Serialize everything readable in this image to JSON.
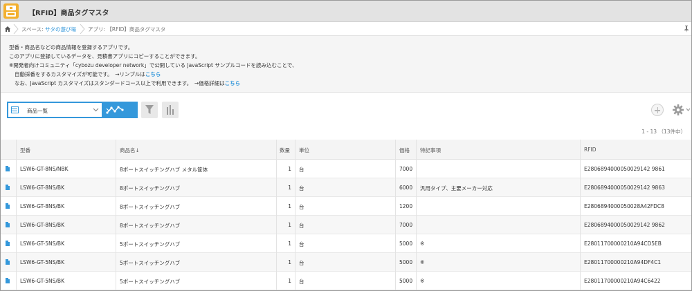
{
  "app": {
    "title": "【RFID】商品タグマスタ"
  },
  "breadcrumb": {
    "space_label": "スペース: ",
    "space_name": "サタの遊び場",
    "app_label": "アプリ: 【RFID】商品タグマスタ"
  },
  "description": {
    "line1": "型番・商品名などの商品情報を登録するアプリです。",
    "line2": "このアプリに登録しているデータを、見積書アプリにコピーすることができます。",
    "line3": "※開発者向けコミュニティ「cybozu developer network」で公開している JavaScript サンプルコードを読み込むことで、",
    "line4_text": "自動採番をするカスタマイズが可能です。　→リンプルは",
    "line4_link": "こちら",
    "line5_text": "なお、JavaScript カスタマイズはスタンダードコース以上で利用できます。　→価格詳細は",
    "line5_link": "こちら"
  },
  "toolbar": {
    "view_selected": "商品一覧",
    "icons": {
      "view": "list-icon",
      "graph": "line-graph-icon",
      "filter": "funnel-icon",
      "chart": "bar-chart-icon",
      "add": "plus-icon",
      "settings": "gear-icon"
    }
  },
  "record_count": "1 - 13 （13件中）",
  "table": {
    "headers": {
      "model": "型番",
      "name": "商品名↓",
      "qty": "数量",
      "unit": "単位",
      "price": "価格",
      "notes": "特記事項",
      "rfid": "RFID"
    },
    "rows": [
      {
        "model": "LSW6-GT-8NS/NBK",
        "name": "8ポートスイッチングハブ メタル筐体",
        "qty": "1",
        "unit": "台",
        "price": "7000",
        "notes": "",
        "rfid": "E2806894000050029142 9861"
      },
      {
        "model": "LSW6-GT-8NS/BK",
        "name": "8ポートスイッチングハブ",
        "qty": "1",
        "unit": "台",
        "price": "6000",
        "notes": "汎用タイプ、主要メーカー対応",
        "rfid": "E2806894000050029142 9863"
      },
      {
        "model": "LSW6-GT-8NS/BK",
        "name": "8ポートスイッチングハブ",
        "qty": "1",
        "unit": "台",
        "price": "1200",
        "notes": "",
        "rfid": "E2806894000050028A42FDC8"
      },
      {
        "model": "LSW6-GT-8NS/BK",
        "name": "8ポートスイッチングハブ",
        "qty": "1",
        "unit": "台",
        "price": "7000",
        "notes": "",
        "rfid": "E2806894000050029142 9862"
      },
      {
        "model": "LSW6-GT-5NS/BK",
        "name": "5ポートスイッチングハブ",
        "qty": "1",
        "unit": "台",
        "price": "5000",
        "notes": "※",
        "rfid": "E28011700000210A94CD5EB"
      },
      {
        "model": "LSW6-GT-5NS/BK",
        "name": "5ポートスイッチングハブ",
        "qty": "1",
        "unit": "台",
        "price": "5000",
        "notes": "※",
        "rfid": "E28011700000210A94DF4C1"
      },
      {
        "model": "LSW6-GT-5NS/BK",
        "name": "5ポートスイッチングハブ",
        "qty": "1",
        "unit": "台",
        "price": "5000",
        "notes": "※",
        "rfid": "E28011700000210A94C6422"
      }
    ]
  },
  "colors": {
    "accent": "#3498db",
    "titlebar": "#e3e3e3",
    "app_icon": "#f3b02f"
  }
}
